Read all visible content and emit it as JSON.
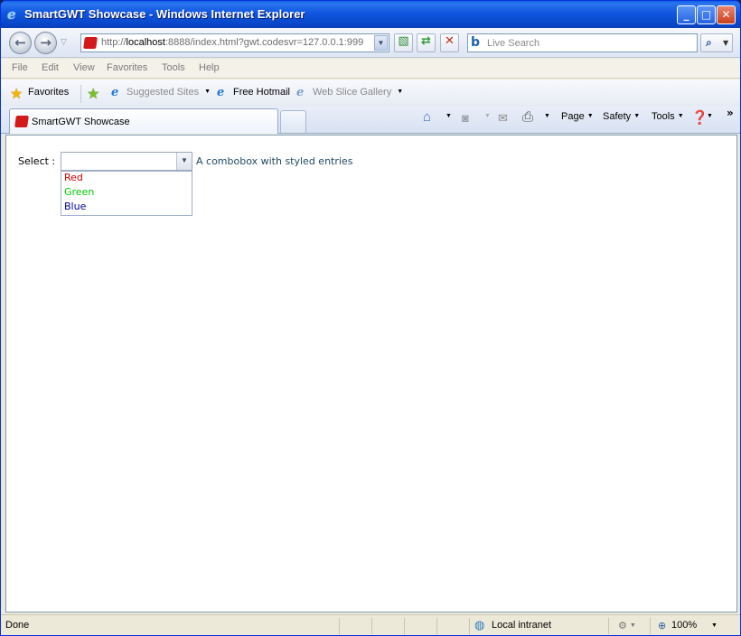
{
  "window": {
    "title": "SmartGWT Showcase - Windows Internet Explorer",
    "controls": {
      "minimize": "_",
      "maximize": "□",
      "close": "✕"
    }
  },
  "address_bar": {
    "url_prefix": "http://",
    "url_host": "localhost",
    "url_rest": ":8888/index.html?gwt.codesvr=127.0.0.1:999",
    "search_placeholder": "Live Search"
  },
  "menu": [
    "File",
    "Edit",
    "View",
    "Favorites",
    "Tools",
    "Help"
  ],
  "favorites_bar": {
    "favorites_label": "Favorites",
    "items": [
      "Suggested Sites",
      "Free Hotmail",
      "Web Slice Gallery"
    ]
  },
  "tabs": [
    {
      "label": "SmartGWT Showcase"
    }
  ],
  "command_bar": {
    "page": "Page",
    "safety": "Safety",
    "tools": "Tools"
  },
  "page": {
    "select_label": "Select :",
    "combo_value": "",
    "combo_hint": "A combobox with styled entries",
    "options": [
      {
        "label": "Red",
        "color": "#cc0000"
      },
      {
        "label": "Green",
        "color": "#00cc00"
      },
      {
        "label": "Blue",
        "color": "#000099"
      }
    ]
  },
  "status_bar": {
    "status": "Done",
    "zone": "Local intranet",
    "zoom": "100%"
  }
}
